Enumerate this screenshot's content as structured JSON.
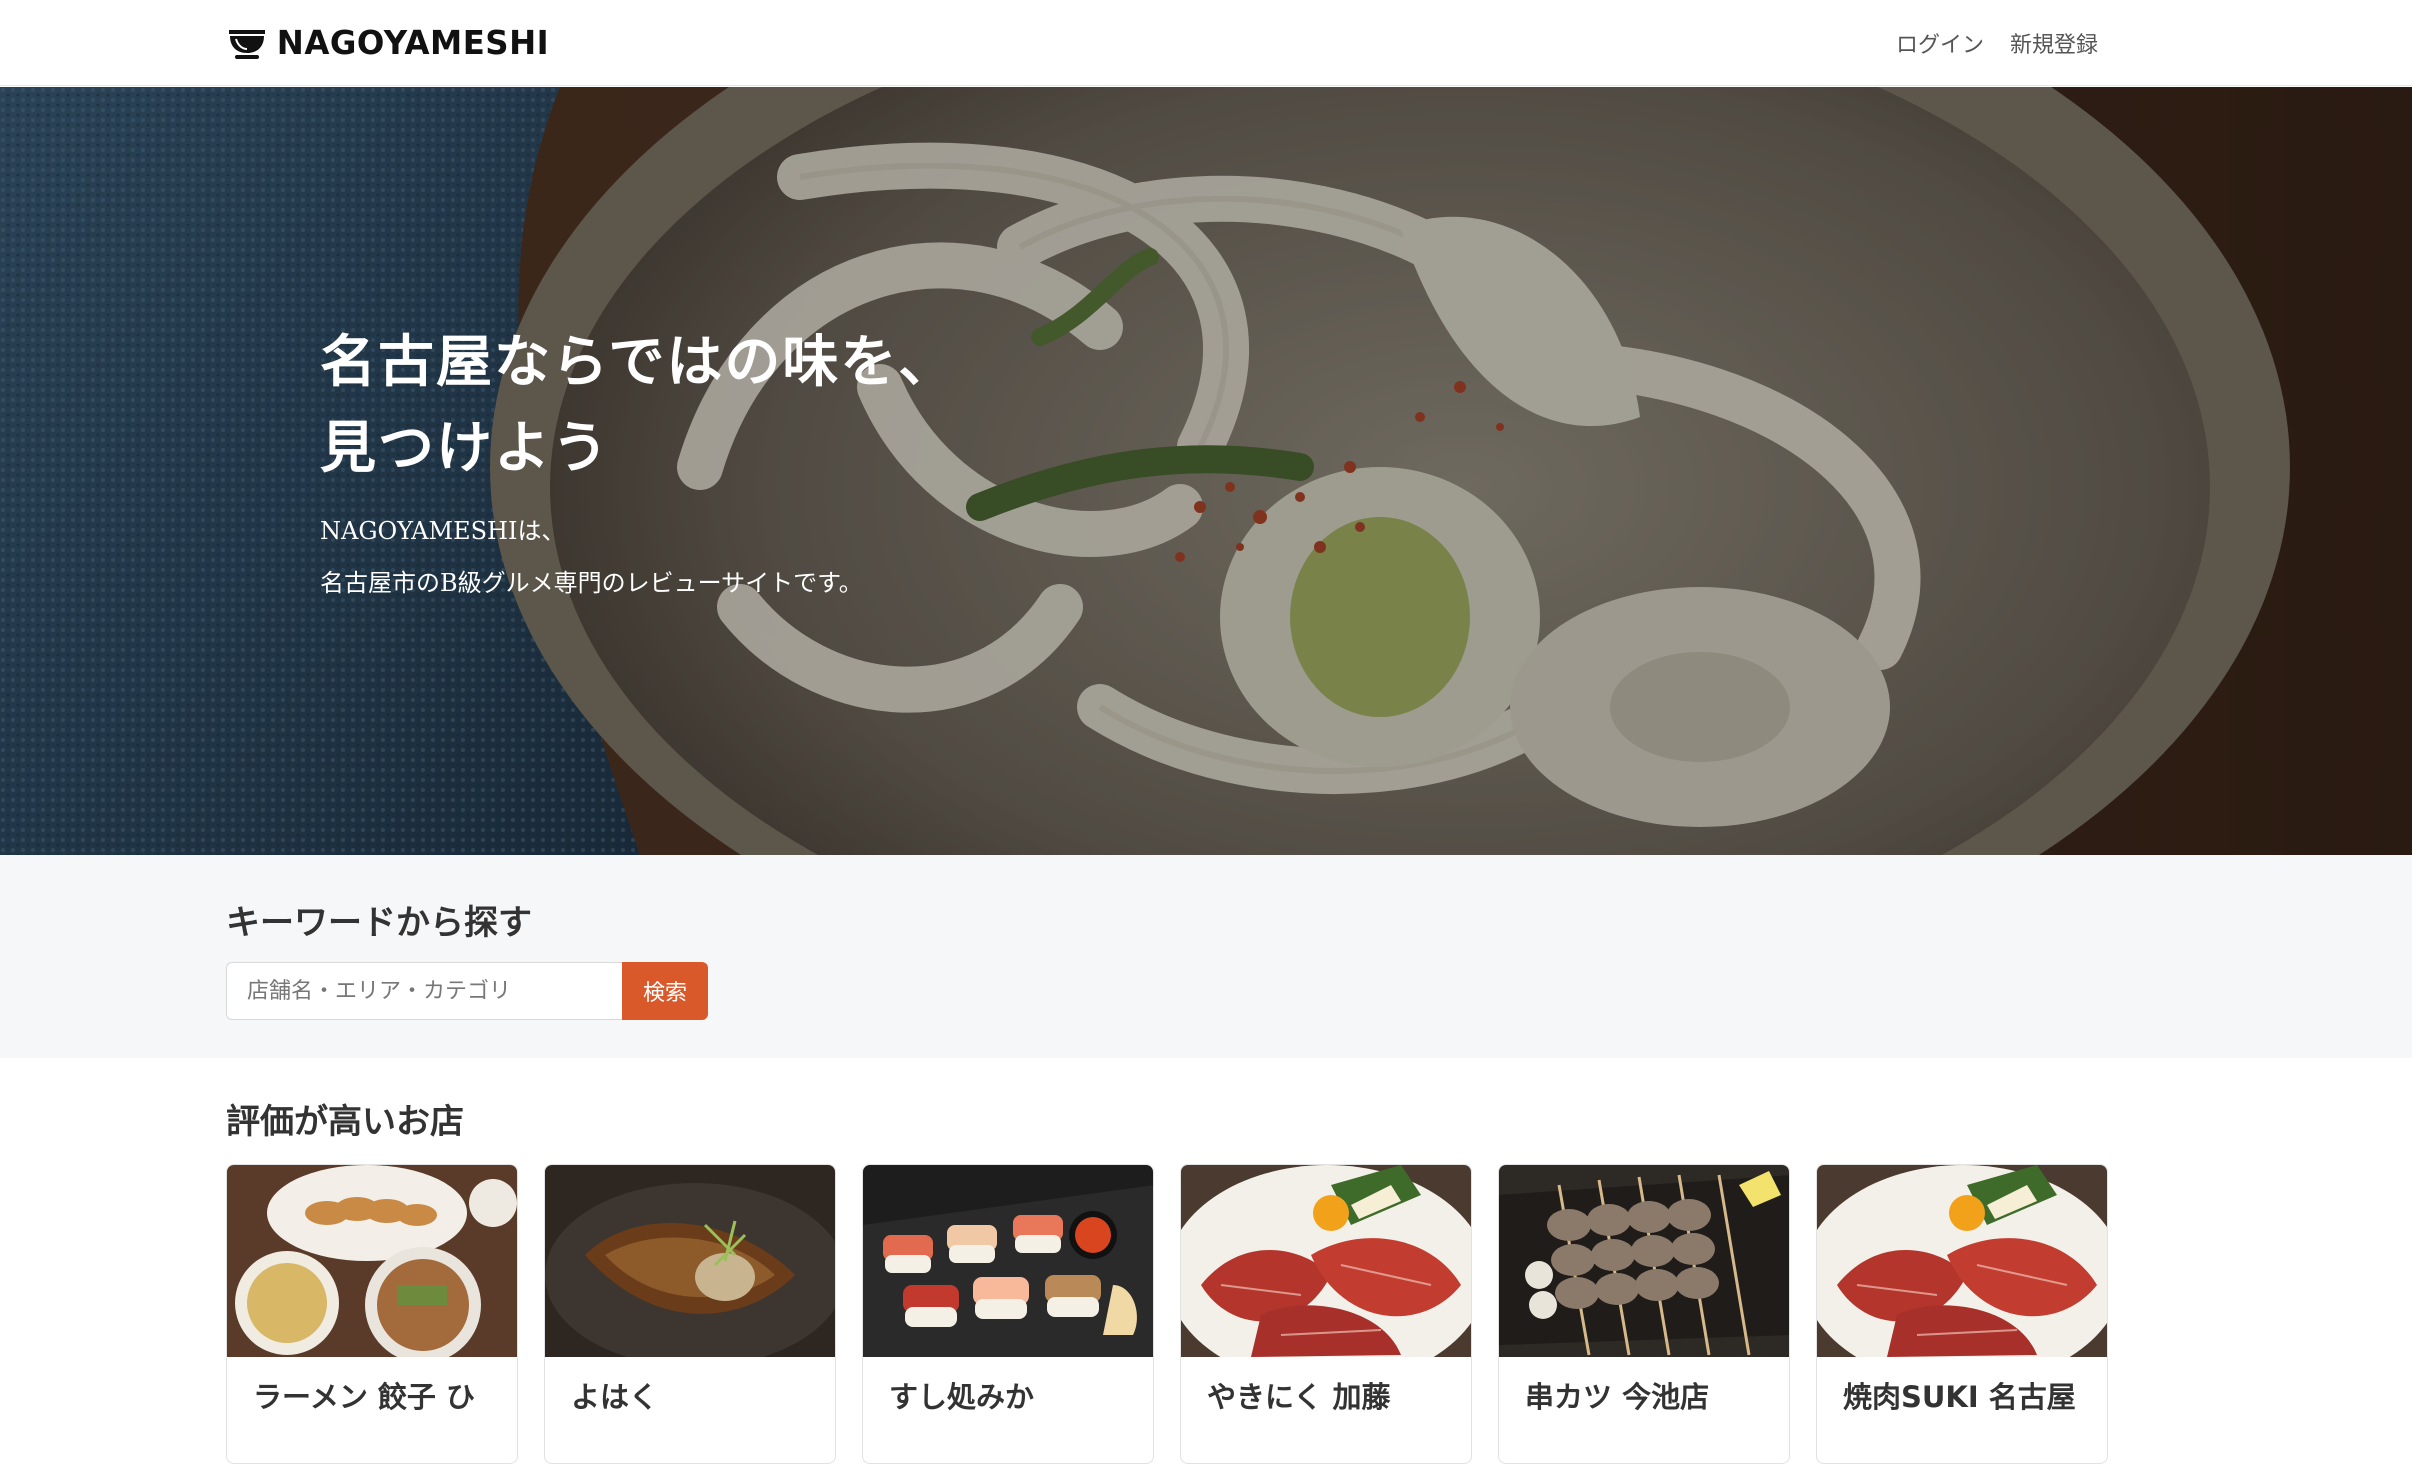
{
  "header": {
    "logo_text": "NAGOYAMESHI",
    "login_label": "ログイン",
    "signup_label": "新規登録"
  },
  "hero": {
    "title_line1": "名古屋ならではの味を、",
    "title_line2": "見つけよう",
    "sub_line1": "NAGOYAMESHIは、",
    "sub_line2": "名古屋市のB級グルメ専門のレビューサイトです。"
  },
  "search": {
    "heading": "キーワードから探す",
    "placeholder": "店舗名・エリア・カテゴリ",
    "button_label": "検索"
  },
  "top_rated": {
    "heading": "評価が高いお店",
    "stores": [
      {
        "name": "ラーメン 餃子 ひ",
        "image": "ramen-gyoza-image"
      },
      {
        "name": "よはく",
        "image": "simmered-fish-image"
      },
      {
        "name": "すし処みか",
        "image": "sushi-image"
      },
      {
        "name": "やきにく 加藤",
        "image": "yakiniku-image"
      },
      {
        "name": "串カツ 今池店",
        "image": "kushi-skewers-image"
      },
      {
        "name": "焼肉SUKI 名古屋",
        "image": "yakiniku-image"
      }
    ]
  },
  "colors": {
    "accent": "#d9592a",
    "search_bg": "#f6f7f9"
  }
}
